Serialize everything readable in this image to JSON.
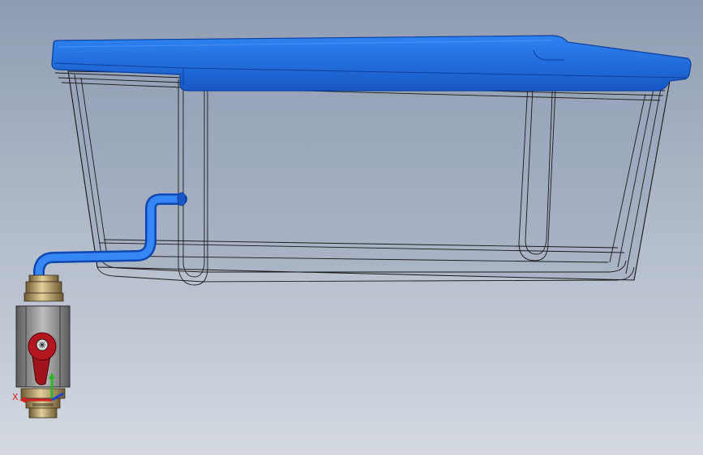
{
  "viewport": {
    "background_top": "#8e9cb2",
    "background_bottom": "#d4d9e1"
  },
  "model": {
    "lid_color": "#1f6fe0",
    "lid_edge_color": "#0b3f9e",
    "pipe_color": "#2a72ea",
    "valve_handle_color": "#a0141c",
    "valve_body_color": "#8a8a8a",
    "fitting_color": "#b89a5a",
    "wireframe_color": "#1a1a1a"
  },
  "triad": {
    "x_label": "X",
    "x_color": "#d21e1e",
    "y_color": "#2bb52b",
    "z_color": "#1e3fd2"
  }
}
